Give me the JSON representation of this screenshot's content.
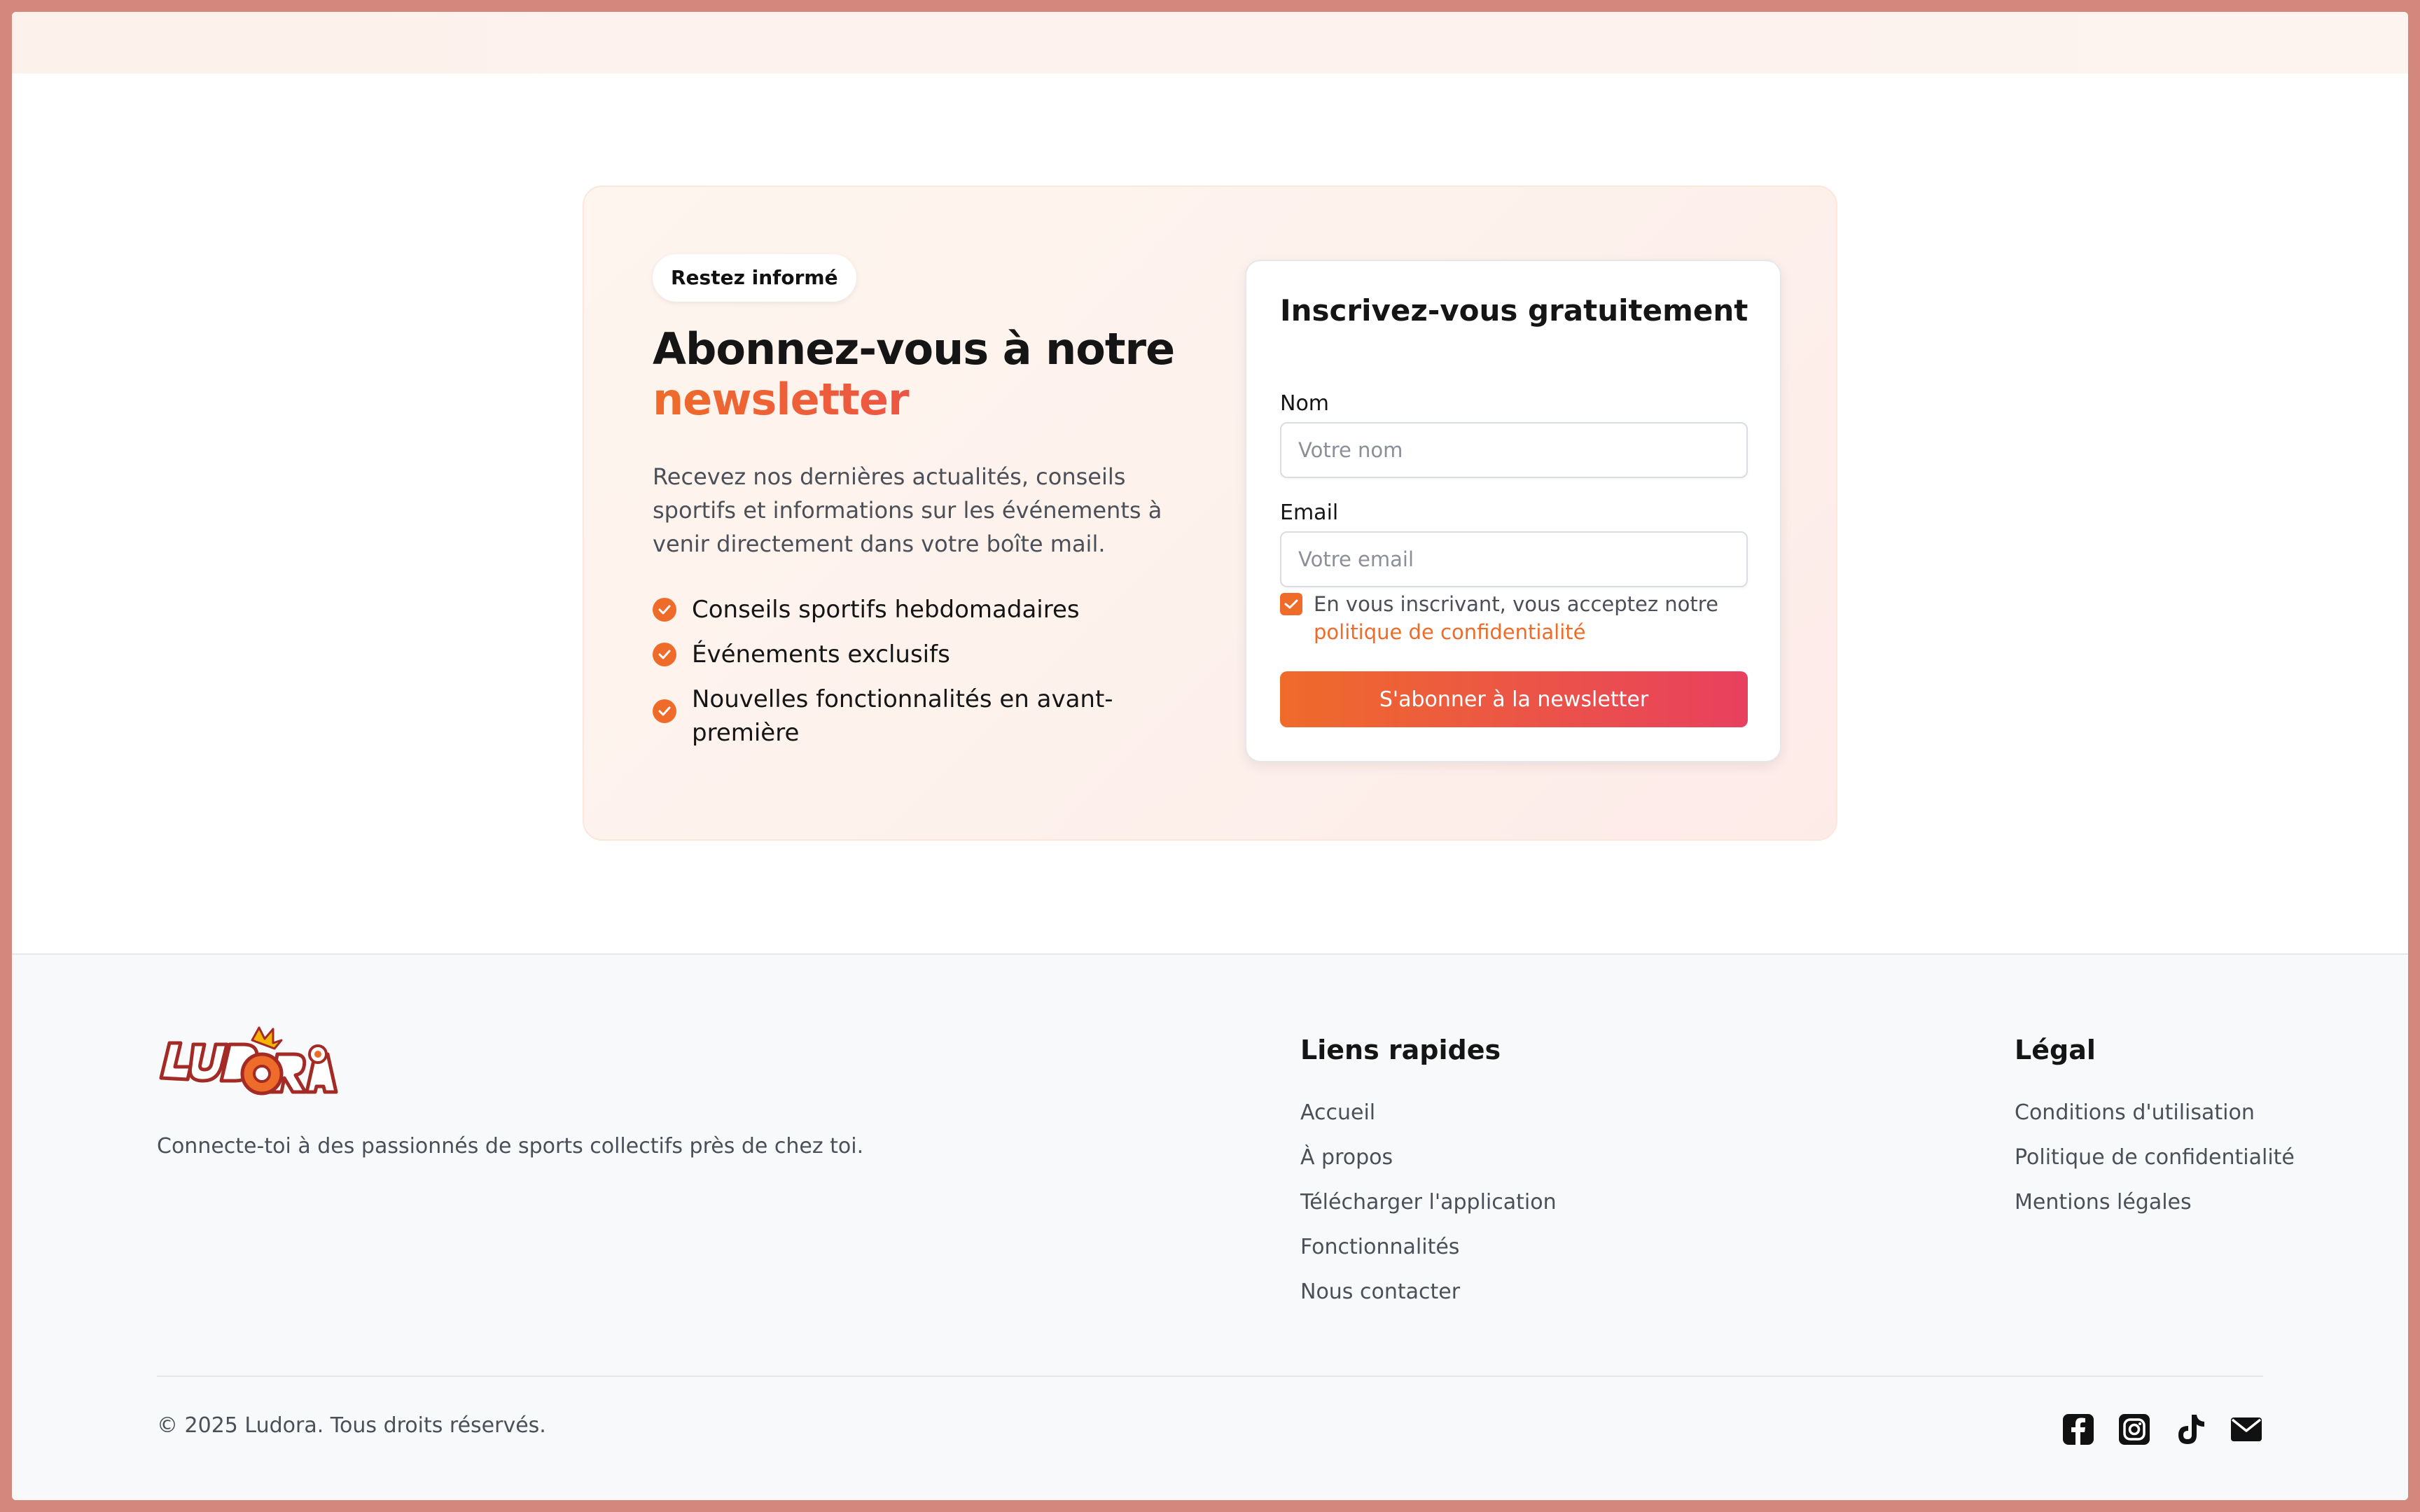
{
  "newsletter": {
    "badge": "Restez informé",
    "headline_line1": "Abonnez-vous à notre",
    "headline_accent": "newsletter",
    "description": "Recevez nos dernières actualités, conseils sportifs et informations sur les événements à venir directement dans votre boîte mail.",
    "features": [
      "Conseils sportifs hebdomadaires",
      "Événements exclusifs",
      "Nouvelles fonctionnalités en avant-première"
    ]
  },
  "form": {
    "title": "Inscrivez-vous gratuitement",
    "name_label": "Nom",
    "name_placeholder": "Votre nom",
    "name_value": "",
    "email_label": "Email",
    "email_placeholder": "Votre email",
    "email_value": "",
    "consent_checked": true,
    "consent_text": "En vous inscrivant, vous acceptez notre",
    "consent_link": "politique de confidentialité",
    "submit_label": "S'abonner à la newsletter"
  },
  "footer": {
    "logo_text": "LUDORA",
    "tagline": "Connecte-toi à des passionnés de sports collectifs près de chez toi.",
    "quick_links_title": "Liens rapides",
    "quick_links": [
      "Accueil",
      "À propos",
      "Télécharger l'application",
      "Fonctionnalités",
      "Nous contacter"
    ],
    "legal_title": "Légal",
    "legal_links": [
      "Conditions d'utilisation",
      "Politique de confidentialité",
      "Mentions légales"
    ],
    "copyright": "© 2025 Ludora. Tous droits réservés.",
    "social_icons": [
      "facebook-icon",
      "instagram-icon",
      "tiktok-icon",
      "email-icon"
    ]
  },
  "colors": {
    "accent_orange": "#ef6b2a",
    "accent_pink": "#e8405f",
    "frame_border": "#d4877c",
    "footer_bg": "#f8f9fb"
  }
}
